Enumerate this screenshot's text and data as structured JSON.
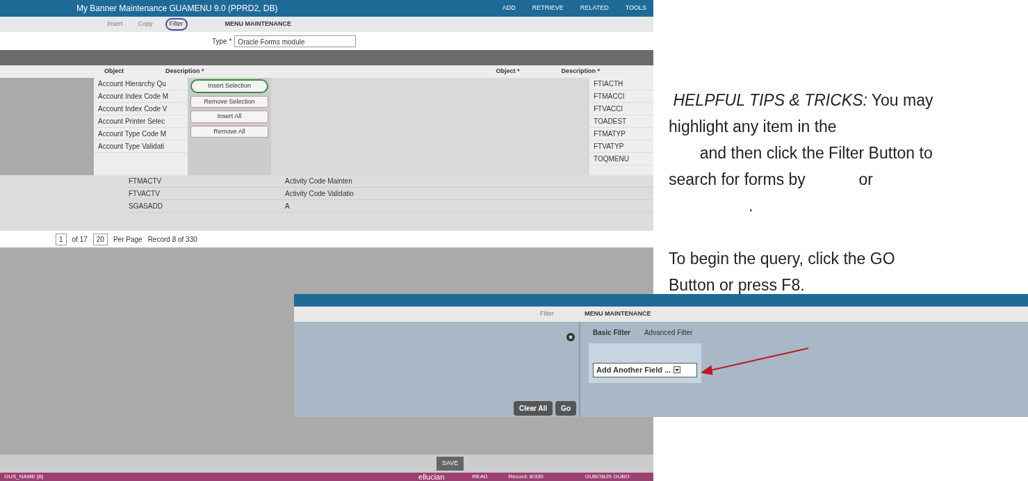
{
  "main_screen": {
    "title": "My Banner Maintenance GUAMENU 9.0 (PPRD2, DB)",
    "header_actions": [
      "ADD",
      "RETRIEVE",
      "RELATED",
      "TOOLS"
    ],
    "toolbar": [
      "Insert",
      "Copy",
      "Filter"
    ],
    "section_title": "MENU MAINTENANCE",
    "type_field": {
      "label": "Type *",
      "value": "Oracle Forms module"
    },
    "left_headers": [
      "Object",
      "Description *"
    ],
    "right_headers": [
      "Object *",
      "Description *"
    ],
    "left_descriptions": [
      "Account Hierarchy Qu",
      "Account Index Code M",
      "Account Index Code V",
      "Account Printer Selec",
      "Account Type Code M",
      "Account Type Validati"
    ],
    "move_buttons": [
      "Insert Selection",
      "Remove Selection",
      "Insert All",
      "Remove All"
    ],
    "right_objects": [
      "FTIACTH",
      "FTMACCI",
      "FTVACCI",
      "TOADEST",
      "FTMATYP",
      "FTVATYP",
      "TOQMENU"
    ],
    "lower_rows": [
      {
        "object": "FTMACTV",
        "description": "Activity Code Mainten"
      },
      {
        "object": "FTVACTV",
        "description": "Activity Code Validatio"
      },
      {
        "object": "SGASADD",
        "description": "A"
      }
    ],
    "pagination": {
      "page": "1",
      "of": "of 17",
      "per_page": "20",
      "per_page_label": "Per Page",
      "record": "Record 8 of 330"
    },
    "save_button": "SAVE",
    "status_bar": {
      "field": "GUS_NAME [8]",
      "brand": "ellucian",
      "mode": "READ",
      "record": "Record: 8/330",
      "form": "GUBOBJS GUBO"
    }
  },
  "filter_screen": {
    "toolbar_button": "Filter",
    "section_title": "MENU MAINTENANCE",
    "tabs": [
      {
        "label": "Basic Filter",
        "selected": true
      },
      {
        "label": "Advanced Filter",
        "selected": false
      }
    ],
    "field_select": "Add Another Field ...",
    "buttons": [
      "Clear All",
      "Go"
    ]
  },
  "tips": {
    "lines": [
      " *HELPFUL TIPS & TRICKS:* You may",
      "highlight any item in the",
      "       and then click the Filter Button to",
      "search for forms by            or",
      "                  ."
    ],
    "paragraph": "To begin the query, click the GO Button or press F8."
  }
}
